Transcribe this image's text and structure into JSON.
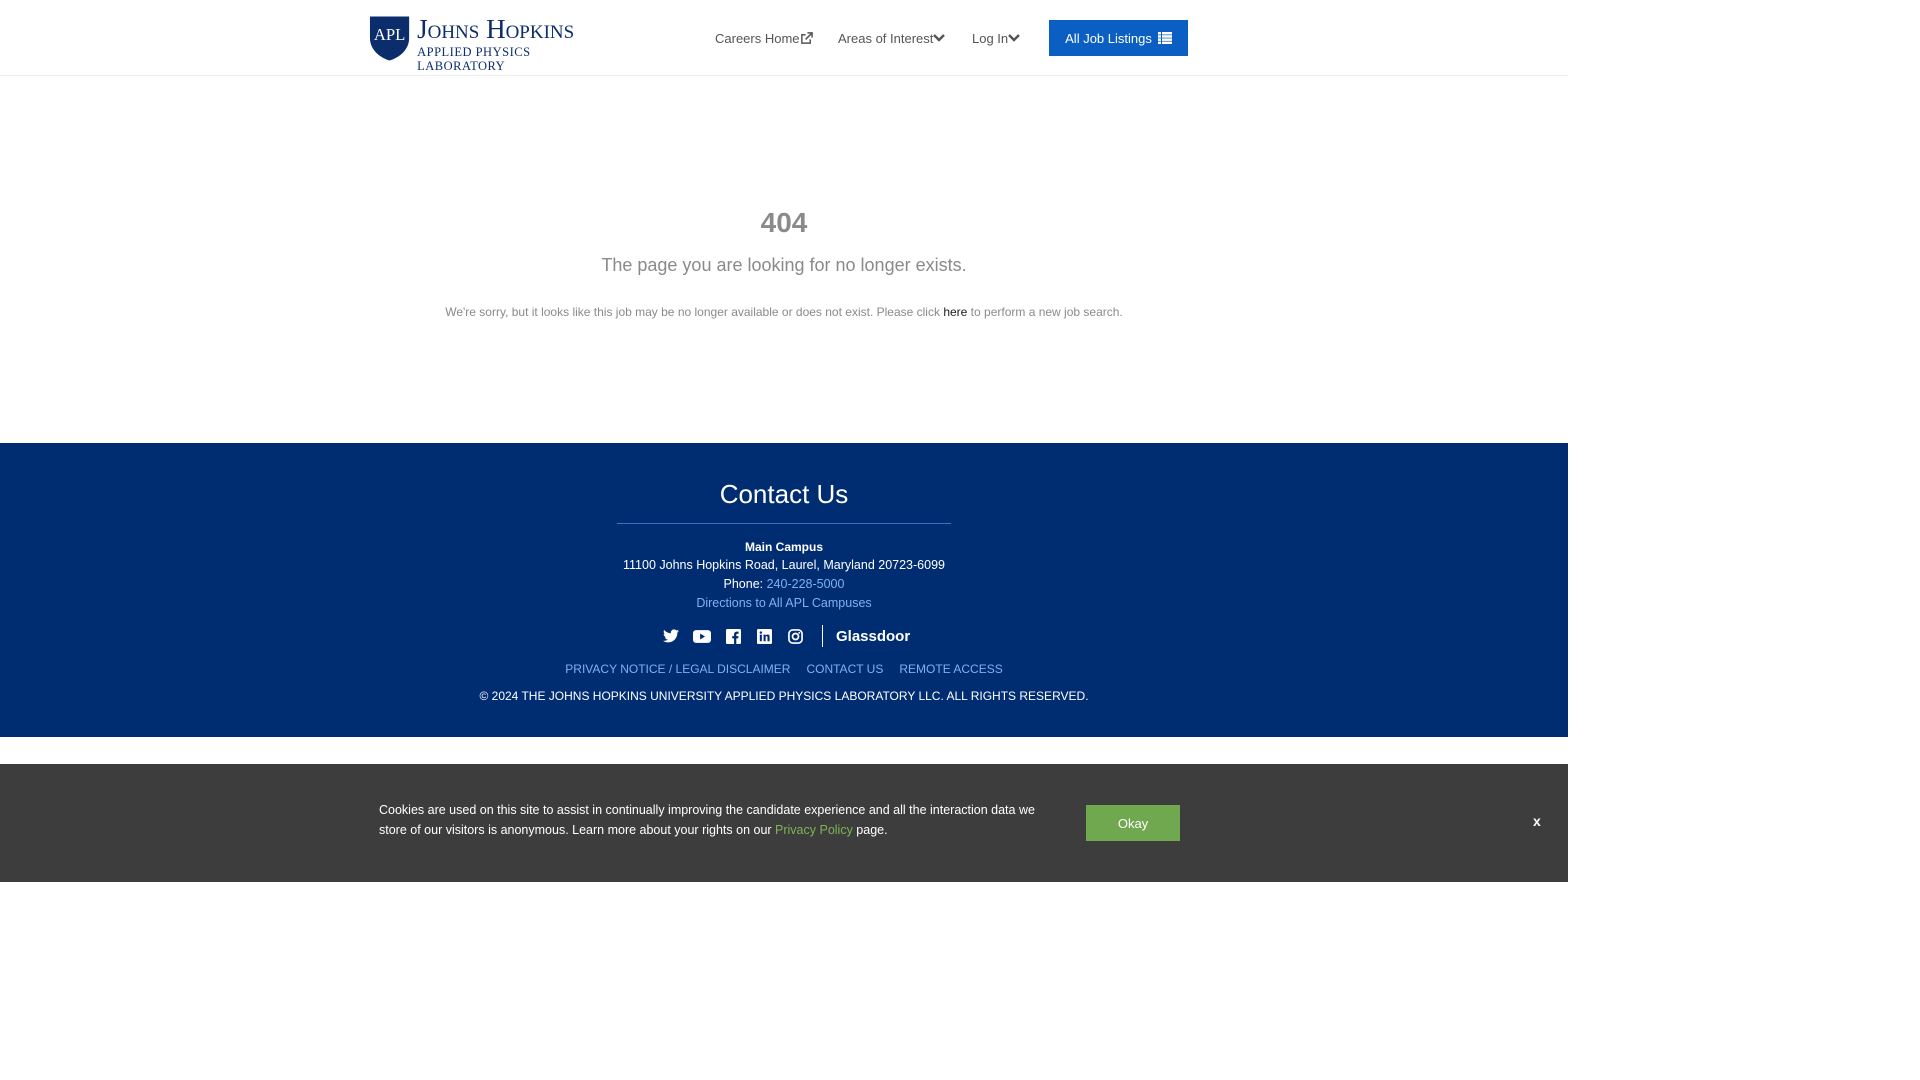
{
  "header": {
    "logo": {
      "shield_text": "APL",
      "line1": "Johns Hopkins",
      "line2": "APPLIED PHYSICS LABORATORY"
    },
    "nav": {
      "careers_home": "Careers Home",
      "areas_of_interest": "Areas of Interest",
      "log_in": "Log In"
    },
    "all_jobs_button": "All Job Listings"
  },
  "main": {
    "error_code": "404",
    "title": "The page you are looking for no longer exists.",
    "description_before": "We're sorry, but it looks like this job may be no longer available or does not exist. Please click ",
    "description_link": "here",
    "description_after": " to perform a new job search."
  },
  "footer": {
    "contact_title": "Contact Us",
    "campus_name": "Main Campus",
    "address": "11100 Johns Hopkins Road, Laurel, Maryland 20723-6099",
    "phone_label": "Phone: ",
    "phone_number": "240-228-5000",
    "directions": "Directions to All APL Campuses",
    "socials": [
      "twitter-icon",
      "youtube-icon",
      "facebook-icon",
      "linkedin-icon",
      "instagram-icon"
    ],
    "glassdoor": "Glassdoor",
    "links": {
      "privacy": "PRIVACY NOTICE / LEGAL DISCLAIMER",
      "contact": "CONTACT US",
      "remote": "REMOTE ACCESS"
    },
    "copyright": "© 2024 THE JOHNS HOPKINS UNIVERSITY APPLIED PHYSICS LABORATORY LLC. ALL RIGHTS RESERVED."
  },
  "cookie": {
    "text_before": "Cookies are used on this site to assist in continually improving the candidate experience and all the interaction data we store of our visitors is anonymous. Learn more about your rights on our ",
    "link": "Privacy Policy",
    "text_after": " page.",
    "okay_button": "Okay",
    "close": "x"
  },
  "colors": {
    "brand_navy": "#002d72",
    "button_blue": "#0b5fc2",
    "cookie_bg": "#3d3d3d",
    "okay_green": "#6fa84e",
    "link_light_blue": "#7fb0f5"
  }
}
